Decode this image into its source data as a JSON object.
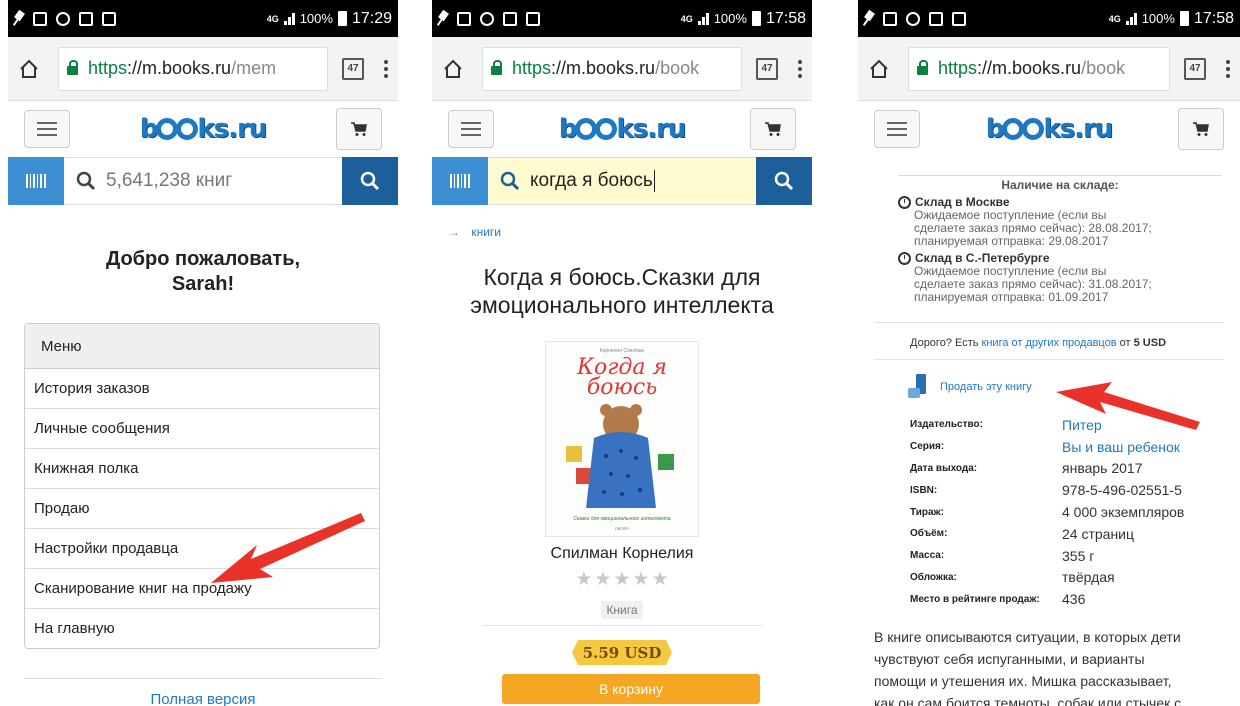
{
  "status": {
    "p1": {
      "battery": "100%",
      "time": "17:29",
      "net": "4G"
    },
    "p2": {
      "battery": "100%",
      "time": "17:58",
      "net": "4G"
    },
    "p3": {
      "battery": "100%",
      "time": "17:58",
      "net": "4G"
    }
  },
  "browser": {
    "tab_count": "47",
    "p1": {
      "scheme": "https",
      "host": "://m.books.ru",
      "path": "/mem"
    },
    "p2": {
      "scheme": "https",
      "host": "://m.books.ru",
      "path": "/book"
    },
    "p3": {
      "scheme": "https",
      "host": "://m.books.ru",
      "path": "/book"
    }
  },
  "site": {
    "logo_a": "b",
    "logo_b": "ks.ru"
  },
  "screen1": {
    "search_placeholder": "5,641,238 книг",
    "welcome_line1": "Добро пожаловать,",
    "welcome_line2": "Sarah!",
    "menu_title": "Меню",
    "menu_items": [
      "История заказов",
      "Личные сообщения",
      "Книжная полка",
      "Продаю",
      "Настройки продавца",
      "Сканирование книг на продажу",
      "На главную"
    ],
    "full_version": "Полная версия"
  },
  "screen2": {
    "search_value": "когда я боюсь",
    "breadcrumb": "книги",
    "title": "Когда я боюсь.Сказки для эмоционального интеллекта",
    "cover": {
      "author_small": "Корнелия Спилман",
      "title_line1": "Когда я",
      "title_line2": "боюсь",
      "subtitle": "Сказки для эмоционального интеллекта",
      "publisher": "ПИТЕР"
    },
    "author": "Спилман Корнелия",
    "type": "Книга",
    "price": "5.59 USD",
    "buy_label": "В корзину"
  },
  "screen3": {
    "stock_title": "Наличие на складе:",
    "warehouses": [
      {
        "name": "Склад в Москве",
        "l1": "Ожидаемое поступление (если вы",
        "l2": "сделаете заказ прямо сейчас): 28.08.2017;",
        "l3": "планируемая отправка: 29.08.2017"
      },
      {
        "name": "Склад в С.-Петербурге",
        "l1": "Ожидаемое поступление (если вы",
        "l2": "сделаете заказ прямо сейчас): 31.08.2017;",
        "l3": "планируемая отправка: 01.09.2017"
      }
    ],
    "other_pre": "Дорого? Есть ",
    "other_link": "книга от других продавцов",
    "other_mid": " от ",
    "other_price": "5 USD",
    "sell_link": "Продать эту книгу",
    "specs": [
      {
        "label": "Издательство:",
        "value": "Питер",
        "link": true
      },
      {
        "label": "Серия:",
        "value": "Вы и ваш ребенок",
        "link": true
      },
      {
        "label": "Дата выхода:",
        "value": "январь 2017",
        "link": false
      },
      {
        "label": "ISBN:",
        "value": "978-5-496-02551-5",
        "link": false
      },
      {
        "label": "Тираж:",
        "value": "4 000 экземпляров",
        "link": false
      },
      {
        "label": "Объём:",
        "value": "24 страниц",
        "link": false
      },
      {
        "label": "Масса:",
        "value": "355 г",
        "link": false
      },
      {
        "label": "Обложка:",
        "value": "твёрдая",
        "link": false
      },
      {
        "label": "Место в рейтинге продаж:",
        "value": "436",
        "link": false
      }
    ],
    "desc_l1": "В книге описываются ситуации, в которых дети",
    "desc_l2": "чувствуют себя испуганными, и варианты",
    "desc_l3": "помощи и утешения их. Мишка рассказывает,",
    "desc_l4": "как он сам боится темноты, собак или стычек с"
  },
  "colors": {
    "brand": "#1f79c2",
    "search_btn": "#1d5f9b",
    "scan_btn": "#3d8fd4",
    "price_tag": "#f5c842",
    "arrow": "#e8322a"
  }
}
